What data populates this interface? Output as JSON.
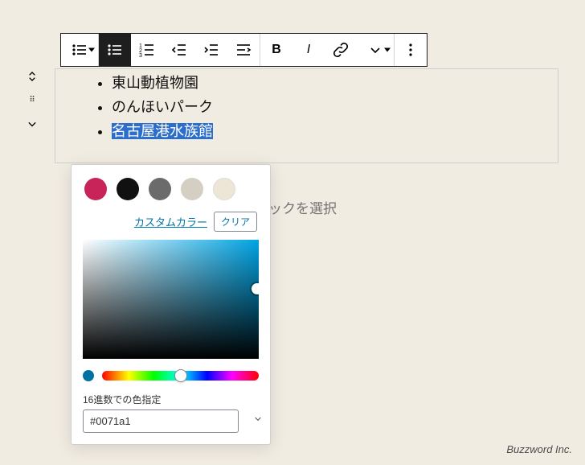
{
  "toolbar": {
    "bullet_list": "bullet-list",
    "numbered_list": "numbered-list",
    "outdent": "outdent",
    "indent": "indent",
    "align": "align",
    "bold": "bold",
    "italic": "italic",
    "link": "link",
    "color": "color",
    "more": "more"
  },
  "list": {
    "items": [
      "東山動植物園",
      "のんほいパーク",
      "名古屋港水族館"
    ]
  },
  "trail_text": "ックを選択",
  "color_picker": {
    "swatches": [
      "#c9245a",
      "#111111",
      "#6b6b6b",
      "#d4cec3",
      "#ede6d6"
    ],
    "custom_color_label": "カスタムカラー",
    "clear_label": "クリア",
    "hex_label": "16進数での色指定",
    "hex_value": "#0071a1",
    "hue_dot": "#0071a1"
  },
  "footer": "Buzzword Inc."
}
